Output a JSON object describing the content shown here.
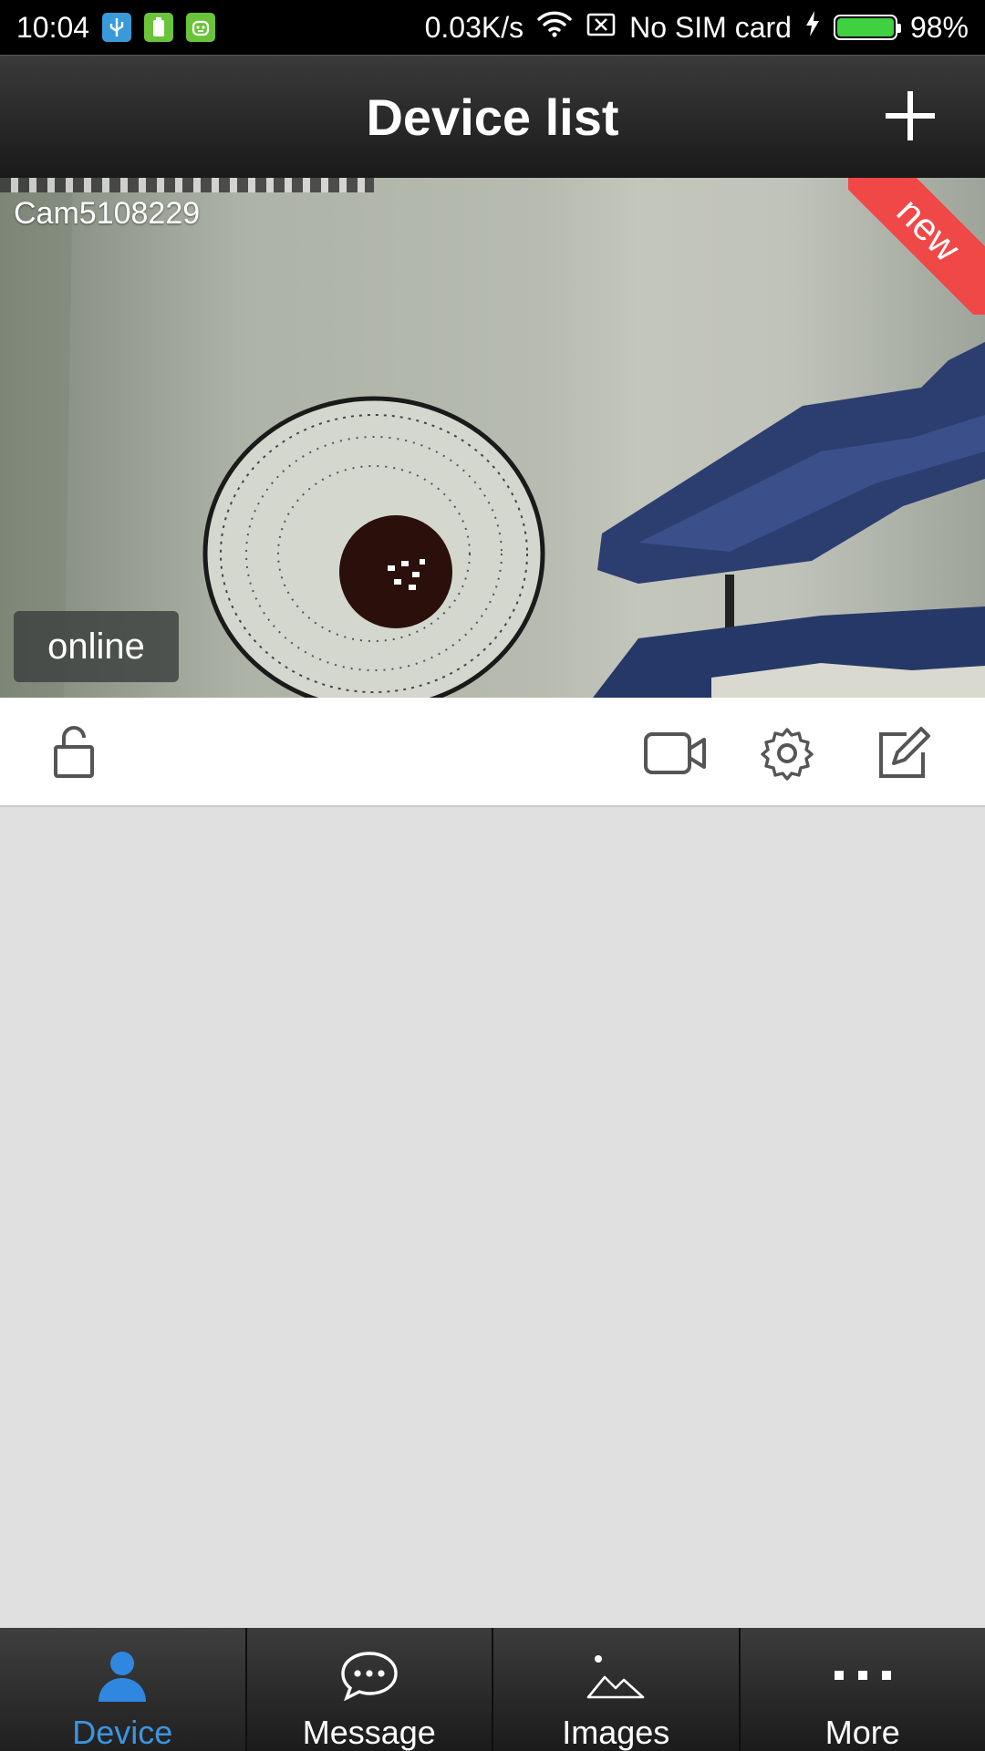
{
  "status_bar": {
    "time": "10:04",
    "network_speed": "0.03K/s",
    "carrier": "No SIM card",
    "battery": "98%"
  },
  "header": {
    "title": "Device list"
  },
  "device": {
    "name": "Cam5108229",
    "badge": "new",
    "status": "online"
  },
  "tabs": [
    {
      "label": "Device",
      "icon": "person-icon",
      "active": true
    },
    {
      "label": "Message",
      "icon": "chat-bubble-icon",
      "active": false
    },
    {
      "label": "Images",
      "icon": "landscape-icon",
      "active": false
    },
    {
      "label": "More",
      "icon": "more-dots-icon",
      "active": false
    }
  ],
  "colors": {
    "accent": "#3c95e0",
    "new_badge": "#f04747",
    "battery": "#3fd13f"
  }
}
